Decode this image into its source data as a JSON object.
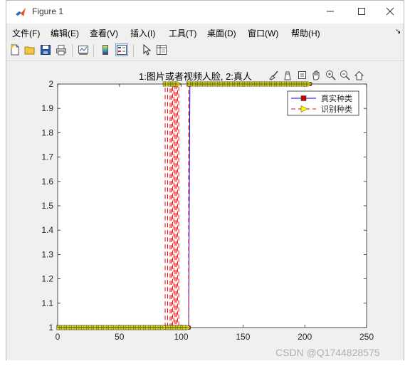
{
  "window": {
    "title": "Figure 1"
  },
  "menu": [
    "文件(F)",
    "编辑(E)",
    "查看(V)",
    "插入(I)",
    "工具(T)",
    "桌面(D)",
    "窗口(W)",
    "帮助(H)"
  ],
  "toolbar_icons": [
    "new-figure-icon",
    "open-file-icon",
    "save-icon",
    "print-icon",
    "link-plot-icon",
    "colorbar-icon",
    "legend-icon",
    "pointer-icon",
    "property-editor-icon"
  ],
  "axes_tools": [
    "brush-icon",
    "data-tip-icon",
    "rotate-icon",
    "pan-icon",
    "zoom-in-icon",
    "zoom-out-icon",
    "home-icon"
  ],
  "watermark": "CSDN @Q1744828575",
  "chart_data": {
    "type": "line",
    "title": "1:图片或者视频人脸, 2:真人",
    "xlabel": "",
    "ylabel": "",
    "xlim": [
      0,
      250
    ],
    "ylim": [
      1,
      2
    ],
    "xticks": [
      0,
      50,
      100,
      150,
      200,
      250
    ],
    "yticks": [
      1,
      1.1,
      1.2,
      1.3,
      1.4,
      1.5,
      1.6,
      1.7,
      1.8,
      1.9,
      2
    ],
    "grid": false,
    "legend_position": "top-right",
    "series": [
      {
        "name": "真实种类",
        "color": "#0000ff",
        "marker": "square",
        "marker_color": "#cc0000",
        "line_style": "solid",
        "segments": [
          {
            "y": 1,
            "x_start": 1,
            "x_end": 106
          },
          {
            "y": 2,
            "x_start": 107,
            "x_end": 204
          }
        ]
      },
      {
        "name": "识别种类",
        "color": "#ff0000",
        "marker": "triangle-right",
        "marker_color": "#ffff00",
        "line_style": "dashed",
        "transitions": [
          87,
          89,
          91,
          92,
          93,
          94,
          95,
          96,
          97,
          98,
          99,
          106
        ],
        "values_note": "",
        "segments": [
          {
            "y": 1,
            "x_start": 1,
            "x_end": 87
          },
          {
            "y": 2,
            "x_start": 87,
            "x_end": 89
          },
          {
            "y": 1,
            "x_start": 89,
            "x_end": 91
          },
          {
            "y": 2,
            "x_start": 91,
            "x_end": 92
          },
          {
            "y": 1,
            "x_start": 92,
            "x_end": 93
          },
          {
            "y": 2,
            "x_start": 93,
            "x_end": 94
          },
          {
            "y": 1,
            "x_start": 94,
            "x_end": 95
          },
          {
            "y": 2,
            "x_start": 95,
            "x_end": 96
          },
          {
            "y": 1,
            "x_start": 96,
            "x_end": 97
          },
          {
            "y": 2,
            "x_start": 97,
            "x_end": 98
          },
          {
            "y": 1,
            "x_start": 98,
            "x_end": 106
          },
          {
            "y": 2,
            "x_start": 106,
            "x_end": 204
          }
        ]
      }
    ]
  }
}
